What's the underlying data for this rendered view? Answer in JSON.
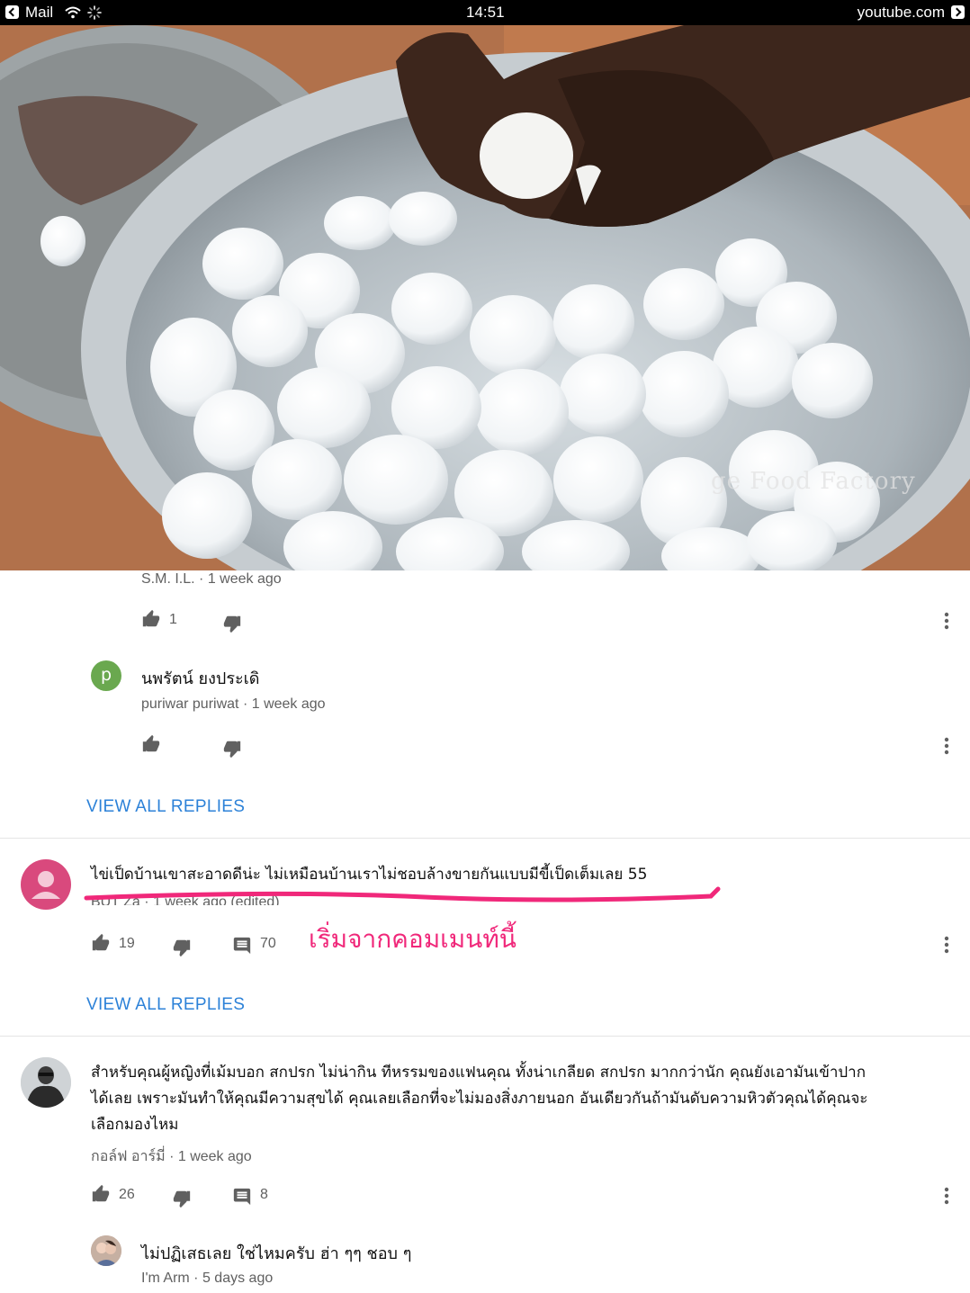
{
  "status_bar": {
    "back_app": "Mail",
    "time": "14:51",
    "site": "youtube.com"
  },
  "video": {
    "watermark": "ge Food Factory"
  },
  "comments": [
    {
      "author": "S.M. I.L.",
      "time": "1 week ago",
      "likes": "1"
    },
    {
      "avatar_letter": "p",
      "text": "นพรัตน์ ยงประเดิ",
      "author": "puriwar puriwat",
      "time": "1 week ago"
    },
    {
      "view_replies": "VIEW ALL REPLIES"
    },
    {
      "text": "ไข่เป็ดบ้านเขาสะอาดดีน่ะ ไม่เหมือนบ้านเราไม่ชอบล้างขายกันแบบมีขี้เป็ดเต็มเลย 55",
      "author": "BUT Za",
      "time": "1 week ago (edited)",
      "likes": "19",
      "replies": "70",
      "view_replies": "VIEW ALL REPLIES",
      "annotation": "เริ่มจากคอมเมนท์นี้"
    },
    {
      "text_lines": [
        "สำหรับคุณผู้หญิงที่เม้มบอก สกปรก ไม่น่ากิน ทีหรรมของแฟนคุณ ทั้งน่าเกลียด สกปรก มากกว่านัก คุณยังเอามันเข้าปาก",
        "ได้เลย เพราะมันทำให้คุณมีความสุขได้ คุณเลยเลือกที่จะไม่มองสิ่งภายนอก อันเดียวกันถ้ามันดับความหิวตัวคุณได้คุณจะ",
        "เลือกมองไหม"
      ],
      "author": "กอล์ฟ อาร์มี่",
      "time": "1 week ago",
      "likes": "26",
      "replies": "8"
    },
    {
      "text": "ไม่ปฏิเสธเลย ใช่ไหมครับ ฮ่า ๆๆ ชอบ ๆ",
      "author": "I'm Arm",
      "time": "5 days ago"
    }
  ],
  "separator": "·",
  "colors": {
    "link": "#2d82d8",
    "annotation": "#f0287a",
    "avatar_green": "#6aa84f",
    "avatar_pink": "#d9497d"
  }
}
